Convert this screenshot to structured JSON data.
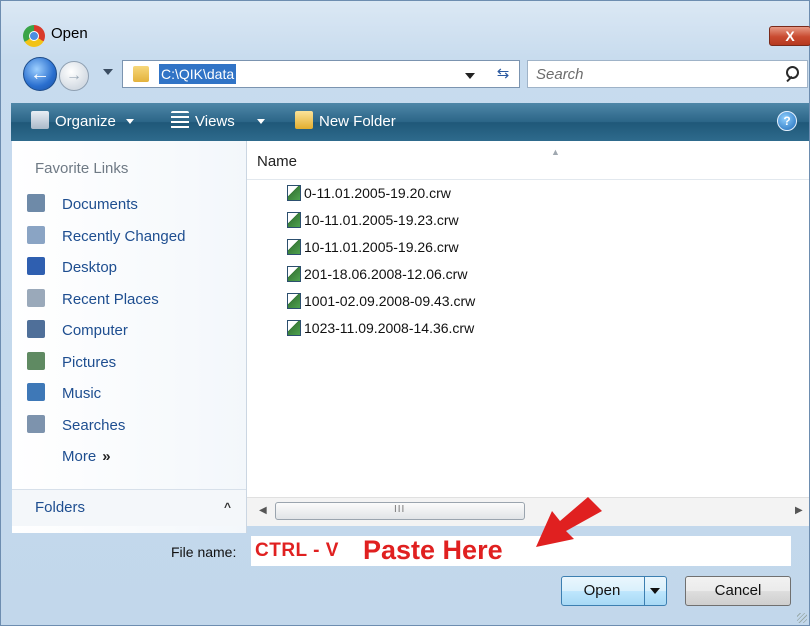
{
  "window": {
    "title": "Open",
    "close_label": "X"
  },
  "nav": {
    "address_path": "C:\\QIK\\data",
    "search_placeholder": "Search",
    "refresh_glyph": "⇆"
  },
  "toolbar": {
    "organize": "Organize",
    "views": "Views",
    "new_folder": "New Folder",
    "help": "?"
  },
  "sidebar": {
    "favorites_title": "Favorite Links",
    "items": [
      {
        "label": "Documents",
        "icon": "documents-icon",
        "color": "#6e8aa8"
      },
      {
        "label": "Recently Changed",
        "icon": "recently-changed-icon",
        "color": "#8aa4c4"
      },
      {
        "label": "Desktop",
        "icon": "desktop-icon",
        "color": "#2f5fb0"
      },
      {
        "label": "Recent Places",
        "icon": "recent-places-icon",
        "color": "#9aa9ba"
      },
      {
        "label": "Computer",
        "icon": "computer-icon",
        "color": "#4f6f99"
      },
      {
        "label": "Pictures",
        "icon": "pictures-icon",
        "color": "#5f8a62"
      },
      {
        "label": "Music",
        "icon": "music-icon",
        "color": "#3e78b7"
      },
      {
        "label": "Searches",
        "icon": "searches-icon",
        "color": "#7d93ad"
      }
    ],
    "more_label": "More",
    "more_glyph": "»",
    "folders_label": "Folders",
    "folders_caret": "^"
  },
  "files": {
    "column_name": "Name",
    "items": [
      "0-11.01.2005-19.20.crw",
      "10-11.01.2005-19.23.crw",
      "10-11.01.2005-19.26.crw",
      "201-18.06.2008-12.06.crw",
      "1001-02.09.2008-09.43.crw",
      "1023-11.09.2008-14.36.crw"
    ],
    "scroll_grip": "III"
  },
  "footer": {
    "file_name_label": "File name:",
    "file_name_value": "CTRL - V",
    "annotation": "Paste Here",
    "open_label": "Open",
    "cancel_label": "Cancel"
  },
  "colors": {
    "annotation": "#e02020",
    "toolbar": "#2b6587",
    "address_selection": "#3174c6"
  }
}
